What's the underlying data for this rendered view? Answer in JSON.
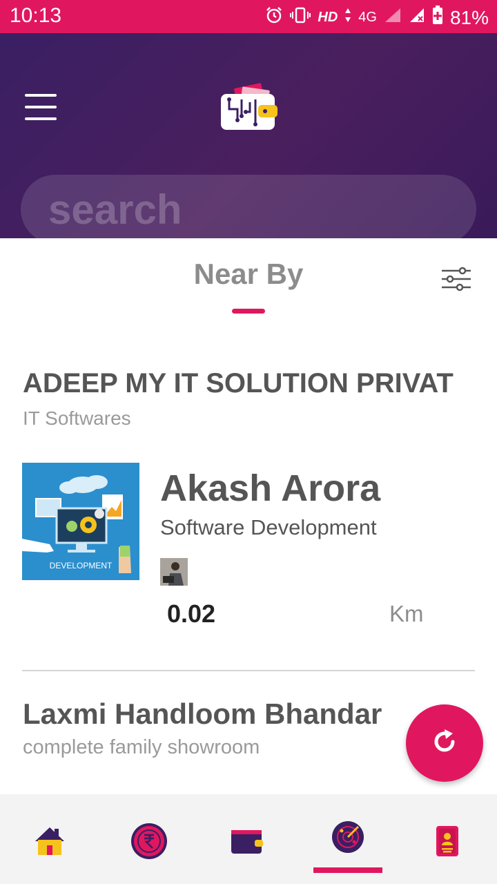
{
  "status_bar": {
    "time": "10:13",
    "network": "HD",
    "network_type": "4G",
    "battery": "81%"
  },
  "header": {
    "menu_icon": "hamburger-menu-icon",
    "logo_icon": "wallet-circuit-logo-icon",
    "search_placeholder": "search"
  },
  "tab": {
    "title": "Near By",
    "filter_icon": "sliders-filter-icon"
  },
  "listings": [
    {
      "business_name": "ADEEP MY IT SOLUTION PRIVAT",
      "category": "IT Softwares",
      "thumbnail_caption": "DEVELOPMENT",
      "contact_name": "Akash Arora",
      "contact_role": "Software Development",
      "distance": "0.02",
      "distance_unit": "Km"
    },
    {
      "business_name": "Laxmi Handloom Bhandar",
      "category": "complete family showroom"
    }
  ],
  "fab": {
    "icon": "refresh-icon"
  },
  "bottom_nav": {
    "items": [
      "home-icon",
      "rupee-coin-icon",
      "wallet-icon",
      "radar-icon",
      "id-card-icon"
    ],
    "active_index": 3
  },
  "colors": {
    "accent": "#e0175f",
    "header_bg": "#3a1f63",
    "text_dark": "#555555",
    "text_muted": "#9a9a9a"
  }
}
